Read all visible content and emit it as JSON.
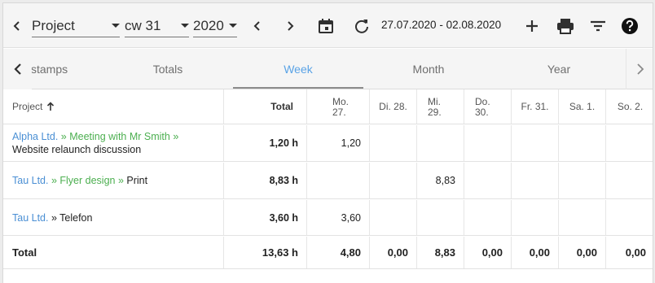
{
  "toolbar": {
    "grouping_select": "Project",
    "week_select": "cw 31",
    "year_select": "2020",
    "date_range": "27.07.2020 - 02.08.2020"
  },
  "tabs": [
    {
      "label": "stamps"
    },
    {
      "label": "Totals"
    },
    {
      "label": "Week"
    },
    {
      "label": "Month"
    },
    {
      "label": "Year"
    }
  ],
  "table": {
    "headers": {
      "project": "Project",
      "total": "Total",
      "days": [
        {
          "line1": "Mo.",
          "line2": "27."
        },
        {
          "line1": "Di. 28.",
          "line2": ""
        },
        {
          "line1": "Mi.",
          "line2": "29."
        },
        {
          "line1": "Do.",
          "line2": "30."
        },
        {
          "line1": "Fr. 31.",
          "line2": ""
        },
        {
          "line1": "Sa. 1.",
          "line2": ""
        },
        {
          "line1": "So. 2.",
          "line2": ""
        }
      ]
    },
    "rows": [
      {
        "customer": "Alpha Ltd.",
        "sep1": " » ",
        "project": "Meeting with Mr Smith",
        "sep2": " » ",
        "task": "Website relaunch discussion",
        "total": "1,20 h",
        "days": [
          "1,20",
          "",
          "",
          "",
          "",
          "",
          ""
        ]
      },
      {
        "customer": "Tau Ltd.",
        "sep1": " » ",
        "project": "Flyer design",
        "sep2": " » ",
        "task": "Print",
        "total": "8,83 h",
        "days": [
          "",
          "",
          "8,83",
          "",
          "",
          "",
          ""
        ]
      },
      {
        "customer": "Tau Ltd.",
        "sep1": " » ",
        "project": "",
        "sep2": "",
        "task": "Telefon",
        "total": "3,60 h",
        "days": [
          "3,60",
          "",
          "",
          "",
          "",
          "",
          ""
        ]
      }
    ],
    "footer": {
      "label": "Total",
      "total": "13,63 h",
      "days": [
        "4,80",
        "0,00",
        "8,83",
        "0,00",
        "0,00",
        "0,00",
        "0,00"
      ]
    }
  },
  "colors": {
    "accent_tab": "#5aa3e6",
    "customer_link": "#4a8fd4",
    "project_link": "#4caf50"
  },
  "icons": [
    "chevron-left-icon",
    "chevron-right-icon",
    "calendar-icon",
    "refresh-icon",
    "add-icon",
    "print-icon",
    "filter-icon",
    "help-icon"
  ]
}
